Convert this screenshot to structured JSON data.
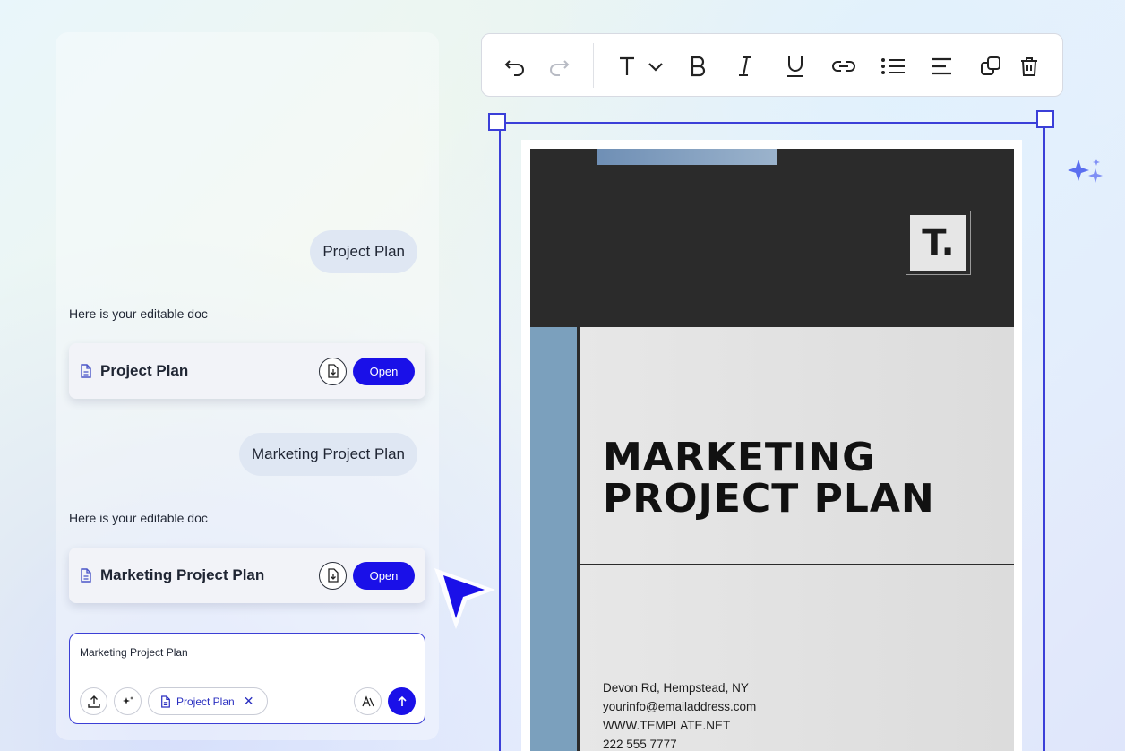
{
  "chat": {
    "messages": [
      {
        "role": "user",
        "text": "Project Plan"
      },
      {
        "role": "assistant",
        "text": "Here is your editable doc"
      },
      {
        "role": "user",
        "text": "Marketing Project Plan"
      },
      {
        "role": "assistant",
        "text": "Here is your editable doc"
      }
    ],
    "cards": [
      {
        "title": "Project Plan",
        "open_label": "Open"
      },
      {
        "title": "Marketing Project Plan",
        "open_label": "Open"
      }
    ],
    "composer": {
      "text": "Marketing Project Plan",
      "chip_label": "Project Plan",
      "chip_close": "✕"
    }
  },
  "toolbar": {
    "items": [
      "undo-icon",
      "redo-icon",
      "text-style-icon",
      "bold-icon",
      "italic-icon",
      "underline-icon",
      "link-icon",
      "bullet-list-icon",
      "align-left-icon",
      "duplicate-icon",
      "delete-icon"
    ]
  },
  "document": {
    "logo": "T.",
    "title_line1": "MARKETING",
    "title_line2": "PROJECT PLAN",
    "address": "Devon Rd, Hempstead, NY",
    "email": "yourinfo@emailaddress.com",
    "website": "WWW.TEMPLATE.NET",
    "phone": "222 555 7777"
  },
  "colors": {
    "accent": "#1a10e8",
    "selection": "#3b3fd8",
    "doc_header": "#2b2b2b",
    "doc_sidebar": "#7ba0bd"
  }
}
